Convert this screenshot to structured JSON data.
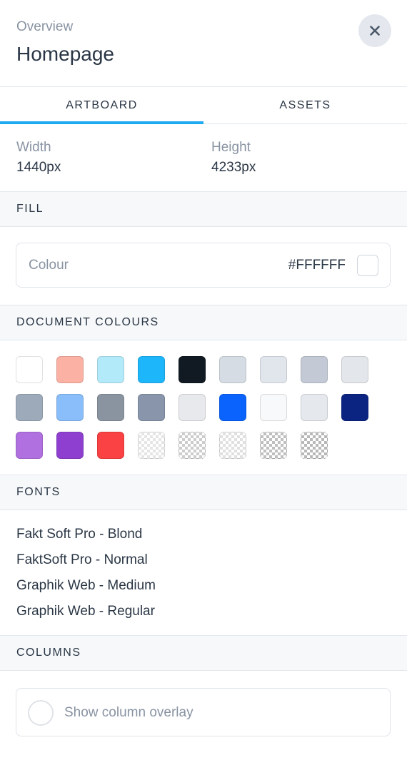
{
  "header": {
    "overline": "Overview",
    "title": "Homepage",
    "close_icon": "close-icon"
  },
  "tabs": [
    {
      "label": "ARTBOARD",
      "active": true
    },
    {
      "label": "ASSETS",
      "active": false
    }
  ],
  "dimensions": {
    "width": {
      "label": "Width",
      "value": "1440px"
    },
    "height": {
      "label": "Height",
      "value": "4233px"
    }
  },
  "fill": {
    "heading": "FILL",
    "colour_label": "Colour",
    "colour_value": "#FFFFFF",
    "colour_hex": "#FFFFFF"
  },
  "document_colours": {
    "heading": "DOCUMENT COLOURS",
    "rows": [
      [
        "#FFFFFF",
        "#FBB1A3",
        "#B3EAFA",
        "#1EB6FA",
        "#111922",
        "#D5DCE3",
        "#E1E6ED",
        "#C3CAD5",
        "#E3E6EA"
      ],
      [
        "#9DAABA",
        "#89BEFA",
        "#8A94A1",
        "#8895AA",
        "#E7E9EC",
        "#0A63FC",
        "#F8F9FA",
        "#E5E8ED",
        "#0B2482"
      ],
      [
        "#B070E0",
        "#8E3FCF",
        "#FA4143",
        "transparent-10",
        "transparent-20",
        "transparent-12",
        "transparent-25",
        "transparent-28"
      ]
    ]
  },
  "fonts": {
    "heading": "FONTS",
    "items": [
      "Fakt Soft Pro - Blond",
      "FaktSoft Pro - Normal",
      "Graphik Web - Medium",
      "Graphik Web - Regular"
    ]
  },
  "columns": {
    "heading": "COLUMNS",
    "toggle_label": "Show column overlay",
    "checked": false
  }
}
